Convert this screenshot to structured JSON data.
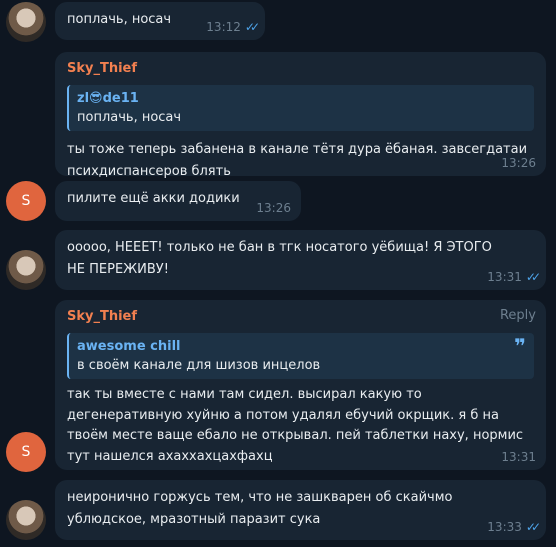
{
  "messages": [
    {
      "text": "поплачь, носач",
      "time": "13:12",
      "read": true
    },
    {
      "sender": "Sky_Thief",
      "quote_name": "zl😎de11",
      "quote_text": "поплачь, носач",
      "text": "ты тоже теперь забанена в канале тётя дура ёбаная. завсегдатаи психдиспансеров блять",
      "time": "13:26"
    },
    {
      "avatar_letter": "S",
      "text": "пилите ещё акки додики",
      "time": "13:26"
    },
    {
      "text": "ооооо, НЕЕЕТ! только не бан в тгк носатого уёбища! Я ЭТОГО НЕ ПЕРЕЖИВУ!",
      "time": "13:31",
      "read": true
    },
    {
      "sender": "Sky_Thief",
      "reply_label": "Reply",
      "quote_name": "awesome chill",
      "quote_text": "в своём канале для шизов инцелов",
      "quote_mark": "❞",
      "text": "так ты вместе с нами там сидел. высирал какую то дегенеративную хуйню а потом удалял ебучий окрщик. я б на твоём месте ваще ебало не открывал. пей таблетки наху, нормис тут нашелся ахаххахцахфахц",
      "time": "13:31",
      "avatar_letter": "S"
    },
    {
      "text": "неиронично горжусь тем, что не зашкварен об скайчмо ублюдское, мразотный паразит сука",
      "time": "13:33",
      "read": true
    }
  ]
}
